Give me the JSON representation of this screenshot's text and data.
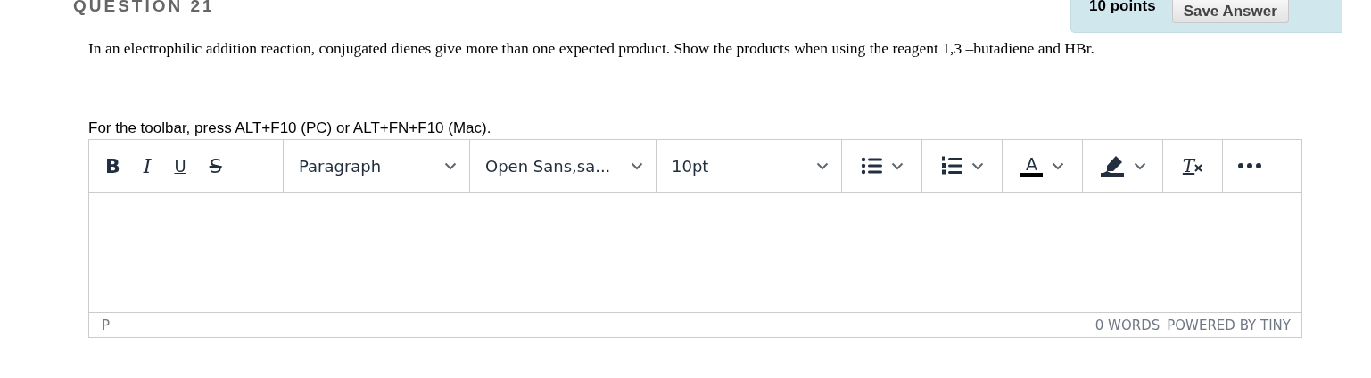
{
  "question": {
    "title": "QUESTION 21",
    "points": "10 points",
    "save_button": "Save Answer",
    "text": "In an electrophilic addition reaction, conjugated dienes give more than one expected product. Show the products when using the reagent  1,3 –butadiene and HBr."
  },
  "toolbar_hint": "For the toolbar, press ALT+F10 (PC) or ALT+FN+F10 (Mac).",
  "toolbar": [
    {
      "kind": "format",
      "items": [
        {
          "label": "B",
          "kind": "bold"
        },
        {
          "label": "I",
          "kind": "italic"
        },
        {
          "label": "U",
          "kind": "underline"
        },
        {
          "label": "S",
          "kind": "strike"
        }
      ]
    },
    {
      "kind": "select",
      "label": "Paragraph"
    },
    {
      "kind": "select",
      "label": "Open Sans,sa..."
    },
    {
      "kind": "select",
      "label": "10pt"
    },
    {
      "kind": "bullets"
    },
    {
      "kind": "numbers"
    },
    {
      "kind": "textcolor",
      "label": "A"
    },
    {
      "kind": "highlight"
    },
    {
      "kind": "clear",
      "label": "T"
    },
    {
      "kind": "more"
    }
  ],
  "status_bar": {
    "path": "P",
    "word_count": "0 WORDS",
    "branding": "POWERED BY TINY"
  }
}
